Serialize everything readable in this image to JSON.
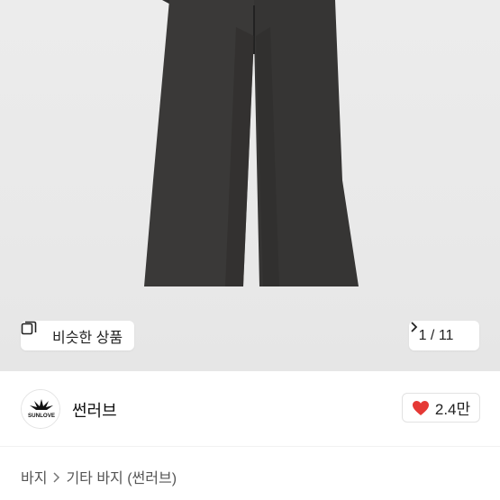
{
  "product_image": {
    "description_icon": "product-photo-pants",
    "similar_button": {
      "label": "비슷한 상품",
      "icon": "copy-icon"
    },
    "pager": {
      "text": "1 / 11",
      "icon": "chevron-right-icon"
    }
  },
  "shop": {
    "name": "썬러브",
    "logo_text": "SUNLOVE",
    "like": {
      "count": "2.4만",
      "icon": "heart-icon",
      "color": "#e53935"
    }
  },
  "breadcrumb": {
    "items": [
      "바지",
      "기타 바지 (썬러브)"
    ],
    "separator_icon": "chevron-right-icon"
  }
}
